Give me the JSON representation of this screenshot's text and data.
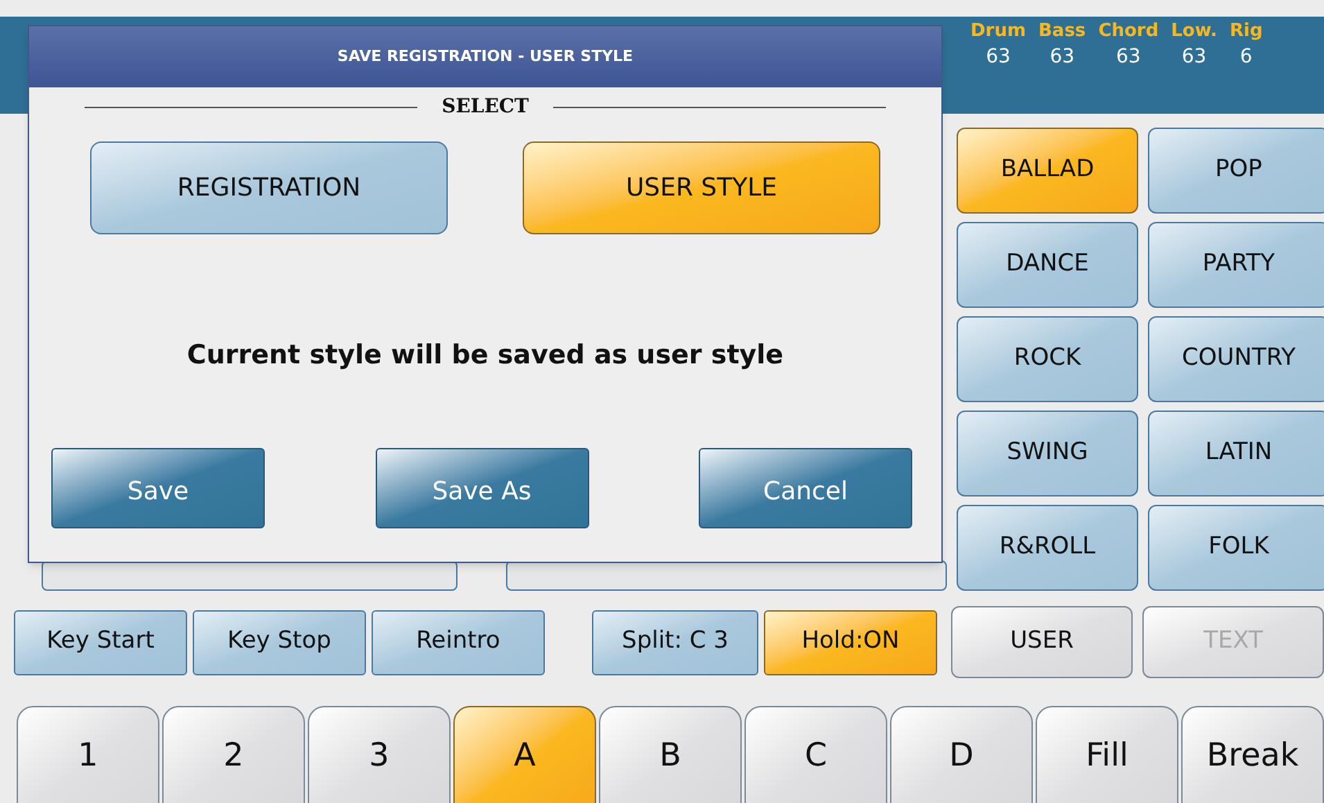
{
  "mixer": [
    {
      "label": "Drum",
      "value": "63"
    },
    {
      "label": "Bass",
      "value": "63"
    },
    {
      "label": "Chord",
      "value": "63"
    },
    {
      "label": "Low.",
      "value": "63"
    },
    {
      "label": "Rig",
      "value": "6"
    }
  ],
  "styles": [
    {
      "label": "BALLAD",
      "selected": true
    },
    {
      "label": "POP",
      "selected": false
    },
    {
      "label": "DANCE",
      "selected": false
    },
    {
      "label": "PARTY",
      "selected": false
    },
    {
      "label": "ROCK",
      "selected": false
    },
    {
      "label": "COUNTRY",
      "selected": false
    },
    {
      "label": "SWING",
      "selected": false
    },
    {
      "label": "LATIN",
      "selected": false
    },
    {
      "label": "R&ROLL",
      "selected": false
    },
    {
      "label": "FOLK",
      "selected": false
    }
  ],
  "banks": [
    {
      "label": "USER",
      "disabled": false
    },
    {
      "label": "TEXT",
      "disabled": true
    }
  ],
  "controls": [
    {
      "label": "Key Start",
      "on": false
    },
    {
      "label": "Key Stop",
      "on": false
    },
    {
      "label": "Reintro",
      "on": false
    },
    {
      "label": "Split: C 3",
      "on": false
    },
    {
      "label": "Hold:ON",
      "on": true
    }
  ],
  "variations": [
    {
      "label": "1",
      "selected": false
    },
    {
      "label": "2",
      "selected": false
    },
    {
      "label": "3",
      "selected": false
    },
    {
      "label": "A",
      "selected": true
    },
    {
      "label": "B",
      "selected": false
    },
    {
      "label": "C",
      "selected": false
    },
    {
      "label": "D",
      "selected": false
    },
    {
      "label": "Fill",
      "selected": false
    },
    {
      "label": "Break",
      "selected": false
    }
  ],
  "dialog": {
    "title": "SAVE REGISTRATION - USER STYLE",
    "section_label": "SELECT",
    "modes": [
      {
        "label": "REGISTRATION",
        "selected": false
      },
      {
        "label": "USER STYLE",
        "selected": true
      }
    ],
    "message": "Current style will be saved as user style",
    "buttons": [
      "Save",
      "Save As",
      "Cancel"
    ]
  }
}
